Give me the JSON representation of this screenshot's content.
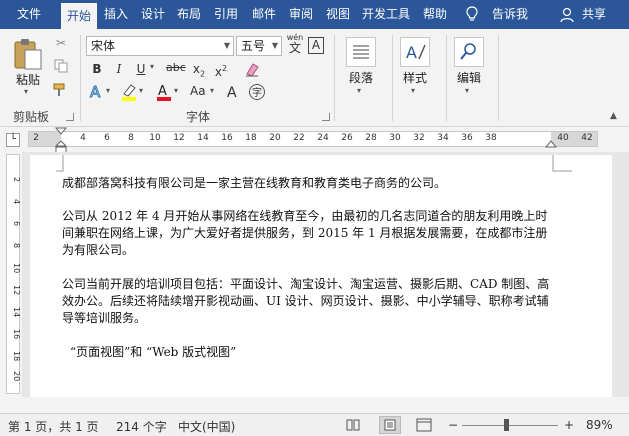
{
  "tabs": [
    "文件",
    "开始",
    "插入",
    "设计",
    "布局",
    "引用",
    "邮件",
    "审阅",
    "视图",
    "开发工具",
    "帮助"
  ],
  "tell_me": "告诉我",
  "share": "共享",
  "clipboard": {
    "paste": "粘贴",
    "group": "剪贴板"
  },
  "font": {
    "name": "宋体",
    "size": "五号",
    "group": "字体",
    "wen_label": "wén",
    "wen_char": "文",
    "boxed_a": "A",
    "abc": "abc",
    "aa": "Aa"
  },
  "paragraph": {
    "label": "段落"
  },
  "styles": {
    "label": "样式"
  },
  "editing": {
    "label": "编辑"
  },
  "ruler": {
    "ticks": [
      "2",
      "2",
      "4",
      "6",
      "8",
      "10",
      "12",
      "14",
      "16",
      "18",
      "20",
      "22",
      "24",
      "26",
      "28",
      "30",
      "32",
      "34",
      "36",
      "38",
      "40",
      "42"
    ]
  },
  "vruler": {
    "ticks": [
      "2",
      "4",
      "6",
      "8",
      "10",
      "12",
      "14",
      "16",
      "18",
      "20",
      "22"
    ]
  },
  "document": {
    "paragraphs": [
      "成都部落窝科技有限公司是一家主营在线教育和教育类电子商务的公司。",
      "公司从 2012 年 4 月开始从事网络在线教育至今，由最初的几名志同道合的朋友利用晚上时间兼职在网络上课，为广大爱好者提供服务，到 2015 年 1 月根据发展需要，在成都市注册为有限公司。",
      "公司当前开展的培训项目包括：平面设计、淘宝设计、淘宝运营、摄影后期、CAD 制图、高效办公。后续还将陆续增开影视动画、UI 设计、网页设计、摄影、中小学辅导、职称考试辅导等培训服务。",
      "“页面视图”和 “Web 版式视图”"
    ]
  },
  "status": {
    "page": "第 1 页，共 1 页",
    "words": "214 个字",
    "lang": "中文(中国)",
    "zoom": "89%",
    "minus": "−",
    "plus": "+"
  },
  "colors": {
    "accent": "#2b579a",
    "highlight": "#ffff00",
    "font_color": "#e81123"
  }
}
